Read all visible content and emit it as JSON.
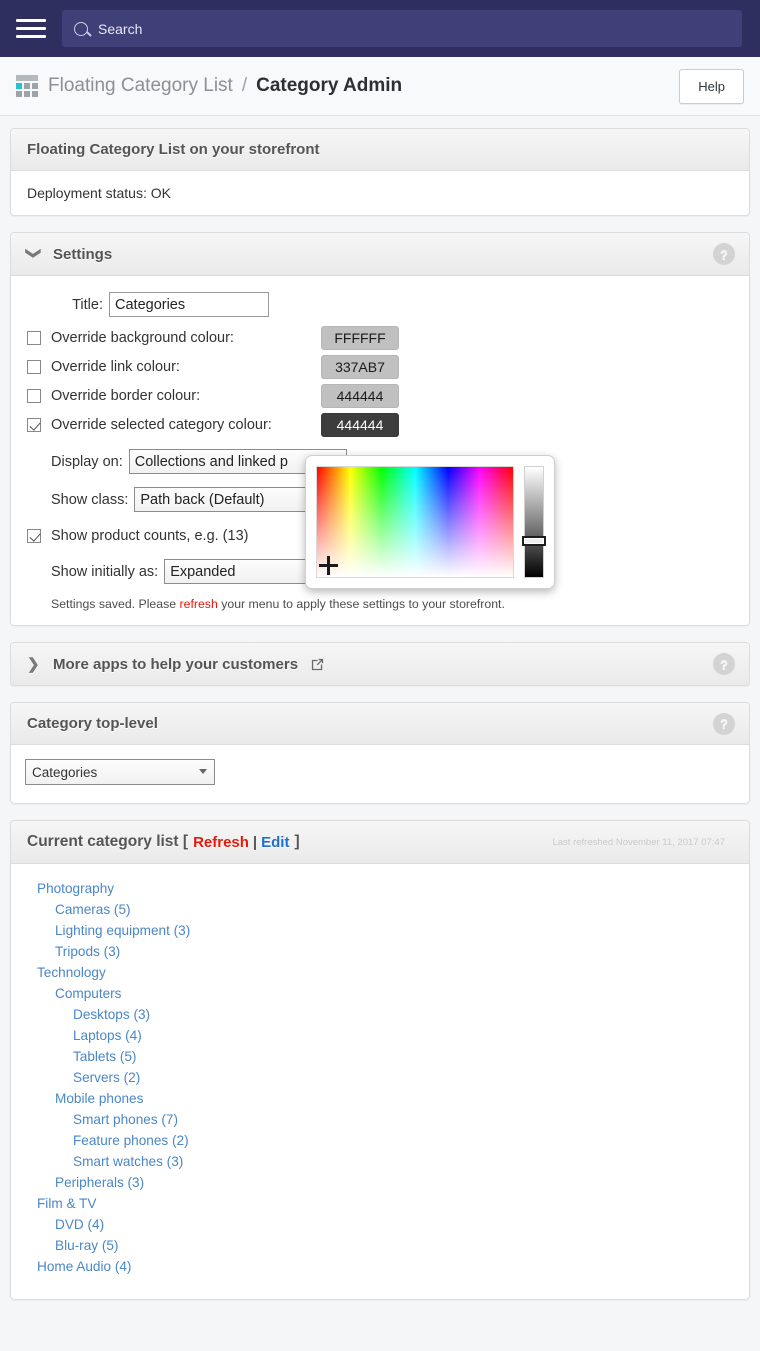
{
  "topbar": {
    "menu_icon": "hamburger-icon",
    "search_icon": "search-icon",
    "search_placeholder": "Search",
    "search_value": "Search"
  },
  "breadcrumb": {
    "app_icon": "grid-app-icon",
    "app_name": "Floating Category List",
    "separator": "/",
    "current": "Category Admin",
    "help_label": "Help"
  },
  "status_card": {
    "title": "Floating Category List on your storefront",
    "body": "Deployment status: OK"
  },
  "settings": {
    "chevron": "chevron-down-icon",
    "title": "Settings",
    "help_badge": "?",
    "title_label": "Title:",
    "title_value": "Categories",
    "rows": [
      {
        "label": "Override background colour:",
        "checked": false,
        "swatch": "FFFFFF",
        "swatch_dark": false
      },
      {
        "label": "Override link colour:",
        "checked": false,
        "swatch": "337AB7",
        "swatch_dark": false
      },
      {
        "label": "Override border colour:",
        "checked": false,
        "swatch": "444444",
        "swatch_dark": false
      },
      {
        "label": "Override selected category colour:",
        "checked": true,
        "swatch": "444444",
        "swatch_dark": true
      }
    ],
    "display_on_label": "Display on:",
    "display_on_value": "Collections and linked p",
    "show_class_label": "Show class:",
    "show_class_value": "Path back (Default)",
    "product_counts_label": "Show product counts, e.g. (13)",
    "product_counts_checked": true,
    "show_initially_label": "Show initially as:",
    "show_initially_value": "Expanded",
    "show_initially_help": "?",
    "saved_note_pre": "Settings saved. Please ",
    "saved_note_link": "refresh",
    "saved_note_post": " your menu to apply these settings to your storefront."
  },
  "colour_picker": {
    "name": "colour-picker-popup",
    "saturation_area": "saturation-value-gradient",
    "crosshair": "picker-crosshair",
    "value_slider": "brightness-slider"
  },
  "more_apps": {
    "chevron": "chevron-right-icon",
    "title": "More apps to help your customers",
    "external_icon": "external-link-icon",
    "help_badge": "?"
  },
  "top_level": {
    "title": "Category top-level",
    "help_badge": "?",
    "select_value": "Categories"
  },
  "category_list": {
    "title": "Current category list [",
    "refresh": "Refresh",
    "pipe": "|",
    "edit": "Edit",
    "title_end": "]",
    "timestamp": "Last refreshed November 11, 2017 07:47",
    "items": [
      {
        "label": "Photography",
        "depth": 0
      },
      {
        "label": "Cameras (5)",
        "depth": 1
      },
      {
        "label": "Lighting equipment (3)",
        "depth": 1
      },
      {
        "label": "Tripods (3)",
        "depth": 1
      },
      {
        "label": "Technology",
        "depth": 0
      },
      {
        "label": "Computers",
        "depth": 1
      },
      {
        "label": "Desktops (3)",
        "depth": 2
      },
      {
        "label": "Laptops (4)",
        "depth": 2
      },
      {
        "label": "Tablets (5)",
        "depth": 2
      },
      {
        "label": "Servers (2)",
        "depth": 2
      },
      {
        "label": "Mobile phones",
        "depth": 1
      },
      {
        "label": "Smart phones (7)",
        "depth": 2
      },
      {
        "label": "Feature phones (2)",
        "depth": 2
      },
      {
        "label": "Smart watches (3)",
        "depth": 2
      },
      {
        "label": "Peripherals (3)",
        "depth": 1
      },
      {
        "label": "Film & TV",
        "depth": 0
      },
      {
        "label": "DVD (4)",
        "depth": 1
      },
      {
        "label": "Blu-ray (5)",
        "depth": 1
      },
      {
        "label": "Home Audio (4)",
        "depth": 0
      }
    ]
  },
  "colors": {
    "topbar": "#2e2f5f",
    "search_field": "#3f4078",
    "link_blue": "#4a87c7",
    "refresh_red": "#e8180c",
    "edit_blue": "#1f6fd0",
    "swatch_bg": "#c0c0c0",
    "swatch_dark_bg": "#3d3d3d"
  }
}
